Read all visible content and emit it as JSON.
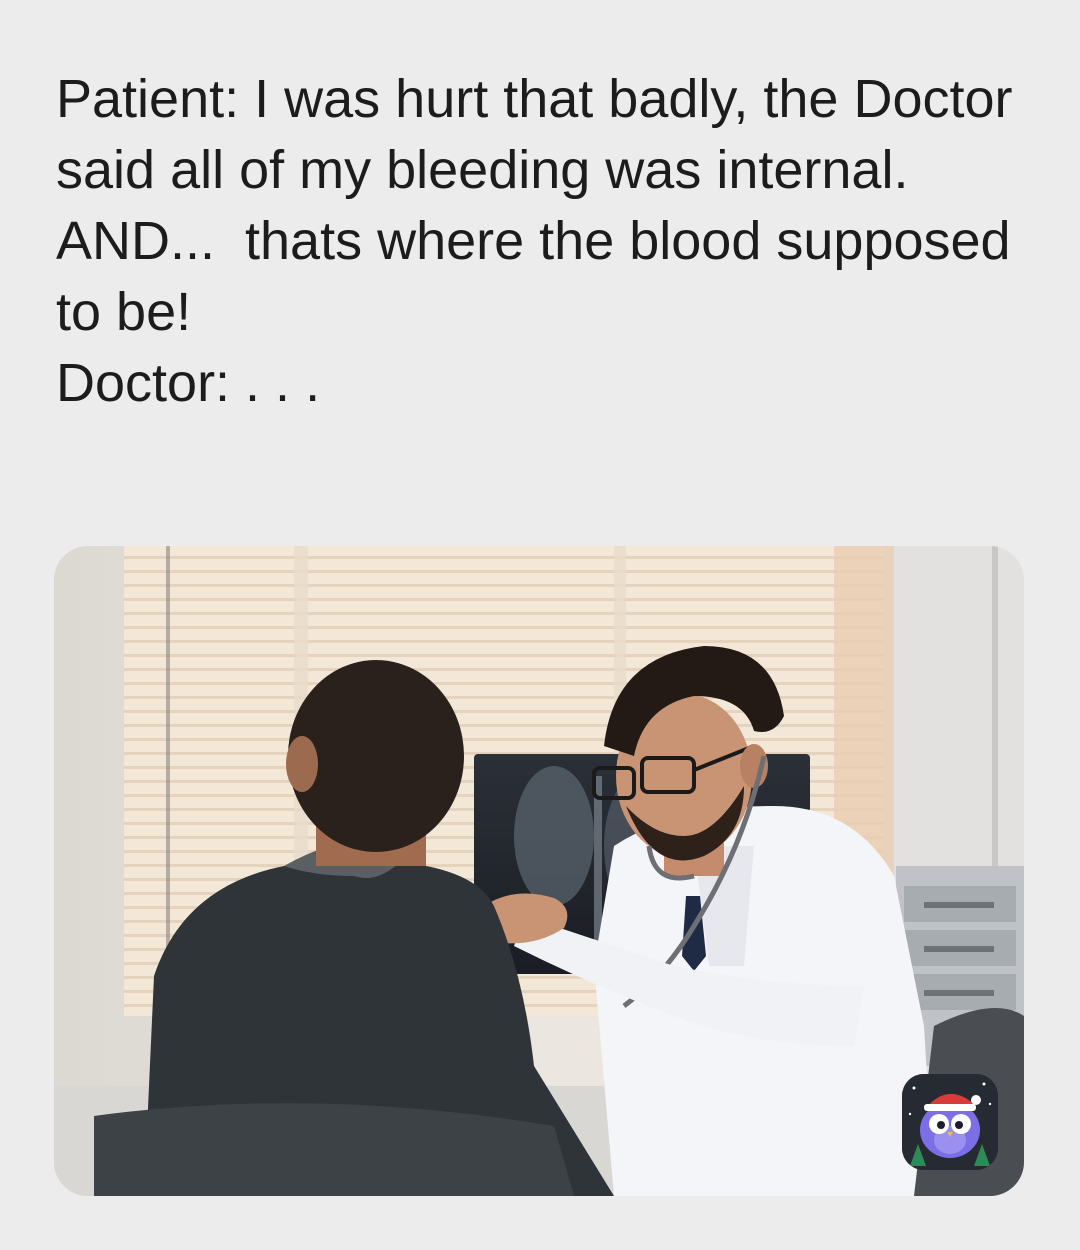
{
  "meme": {
    "caption": "Patient: I was hurt that badly, the Doctor said all of my bleeding was internal. AND...  thats where the blood supposed to be!\nDoctor: . . ."
  },
  "image": {
    "description_icon": "doctor-examining-patient-photo"
  },
  "badge": {
    "icon": "owl-santa-hat-app-icon"
  }
}
